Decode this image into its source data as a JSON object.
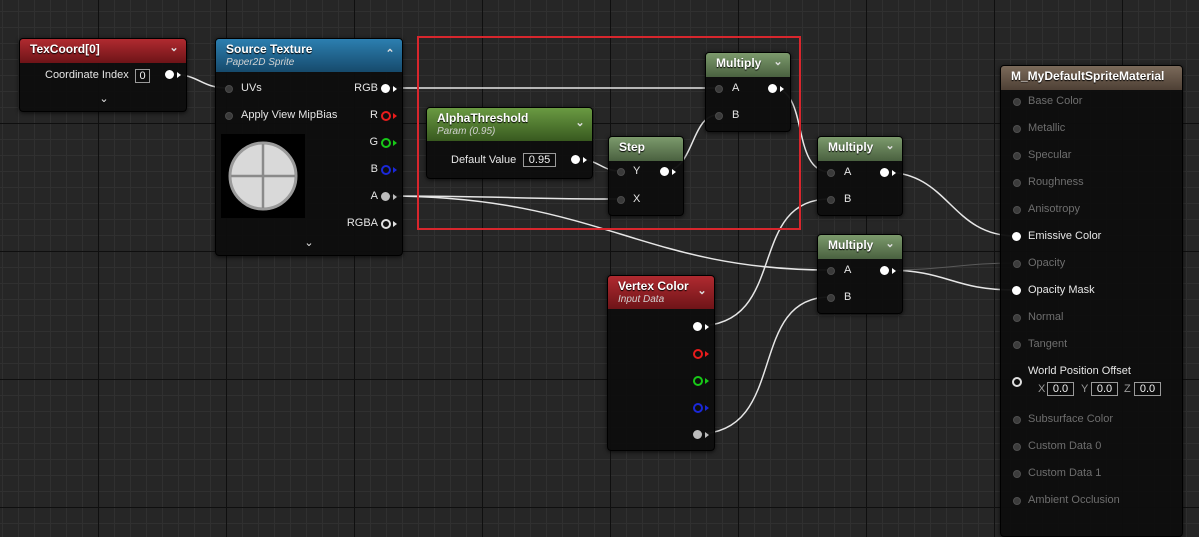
{
  "nodes": {
    "texcoord": {
      "title": "TexCoord[0]",
      "field_label": "Coordinate Index",
      "field_value": "0"
    },
    "source_texture": {
      "title": "Source Texture",
      "subtitle": "Paper2D Sprite",
      "pins": {
        "uvs": "UVs",
        "apply_view_mipbias": "Apply View MipBias",
        "rgb": "RGB",
        "r": "R",
        "g": "G",
        "b": "B",
        "a": "A",
        "rgba": "RGBA"
      }
    },
    "alpha_threshold": {
      "title": "AlphaThreshold",
      "subtitle": "Param (0.95)",
      "field_label": "Default Value",
      "field_value": "0.95"
    },
    "step": {
      "title": "Step",
      "pin_y": "Y",
      "pin_x": "X"
    },
    "multiply_1": {
      "title": "Multiply",
      "pin_a": "A",
      "pin_b": "B"
    },
    "multiply_2": {
      "title": "Multiply",
      "pin_a": "A",
      "pin_b": "B"
    },
    "multiply_3": {
      "title": "Multiply",
      "pin_a": "A",
      "pin_b": "B"
    },
    "vertex_color": {
      "title": "Vertex Color",
      "subtitle": "Input Data"
    },
    "material_output": {
      "title": "M_MyDefaultSpriteMaterial",
      "pins": {
        "base_color": "Base Color",
        "metallic": "Metallic",
        "specular": "Specular",
        "roughness": "Roughness",
        "anisotropy": "Anisotropy",
        "emissive_color": "Emissive Color",
        "opacity": "Opacity",
        "opacity_mask": "Opacity Mask",
        "normal": "Normal",
        "tangent": "Tangent",
        "world_position_offset": "World Position Offset",
        "subsurface_color": "Subsurface Color",
        "custom_data_0": "Custom Data 0",
        "custom_data_1": "Custom Data 1",
        "ambient_occlusion": "Ambient Occlusion"
      },
      "wpo": {
        "x_label": "X",
        "x_value": "0.0",
        "y_label": "Y",
        "y_value": "0.0",
        "z_label": "Z",
        "z_value": "0.0"
      }
    }
  },
  "colors": {
    "texcoord_header": "#8f1d22",
    "texture_header": "#1d5f86",
    "param_header": "#4d7a2f",
    "math_header": "#5e7a52",
    "vertex_color_header": "#8f1d22",
    "result_header": "#6b5a4a",
    "selection_box": "#d8262d",
    "wire": "#e8e8e8"
  },
  "icons": {
    "collapse": "chevron-down-icon",
    "expand": "chevron-up-icon",
    "texture_preview": "circle-quadrant-preview-icon"
  }
}
